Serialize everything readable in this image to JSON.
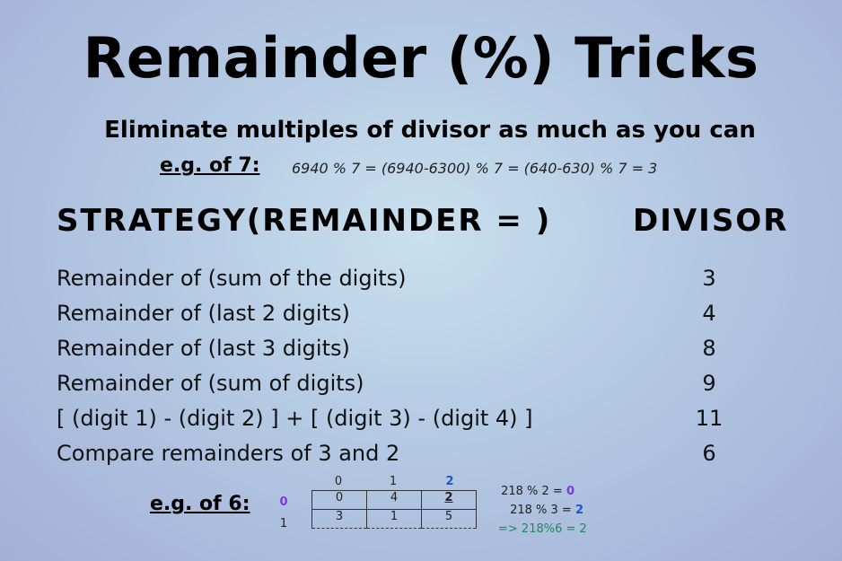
{
  "title": "Remainder (%) Tricks",
  "subtitle": "Eliminate multiples of divisor as much as you can",
  "example7": {
    "label": "e.g. of 7:",
    "expression": "6940 % 7 = (6940-6300) % 7 = (640-630) % 7 = 3"
  },
  "headings": {
    "strategy": "STRATEGY(REMAINDER = )",
    "divisor": "DIVISOR"
  },
  "rules": [
    {
      "strategy": "Remainder of (sum of the digits)",
      "divisor": "3"
    },
    {
      "strategy": "Remainder of (last 2 digits)",
      "divisor": "4"
    },
    {
      "strategy": "Remainder of (last 3 digits)",
      "divisor": "8"
    },
    {
      "strategy": "Remainder of (sum of digits)",
      "divisor": "9"
    },
    {
      "strategy": "[ (digit 1) - (digit 2) ] + [ (digit 3) - (digit 4) ]",
      "divisor": "11"
    },
    {
      "strategy": "Compare remainders of 3 and 2",
      "divisor": "6"
    }
  ],
  "example6": {
    "label": "e.g. of 6:",
    "column_headers": [
      "0",
      "1",
      "2"
    ],
    "row_headers": [
      "0",
      "1"
    ],
    "grid": [
      [
        "0",
        "4",
        "2"
      ],
      [
        "3",
        "1",
        "5"
      ]
    ],
    "calc_lines": [
      {
        "text": "218 % 2 = ",
        "result": "0"
      },
      {
        "text": "218 % 3 = ",
        "result": "2"
      },
      {
        "text": "=> 218%6 = 2",
        "result": ""
      }
    ]
  },
  "colors": {
    "blue": "#1a56c4",
    "purple": "#7a3ae0",
    "green": "#1f7a4a"
  }
}
